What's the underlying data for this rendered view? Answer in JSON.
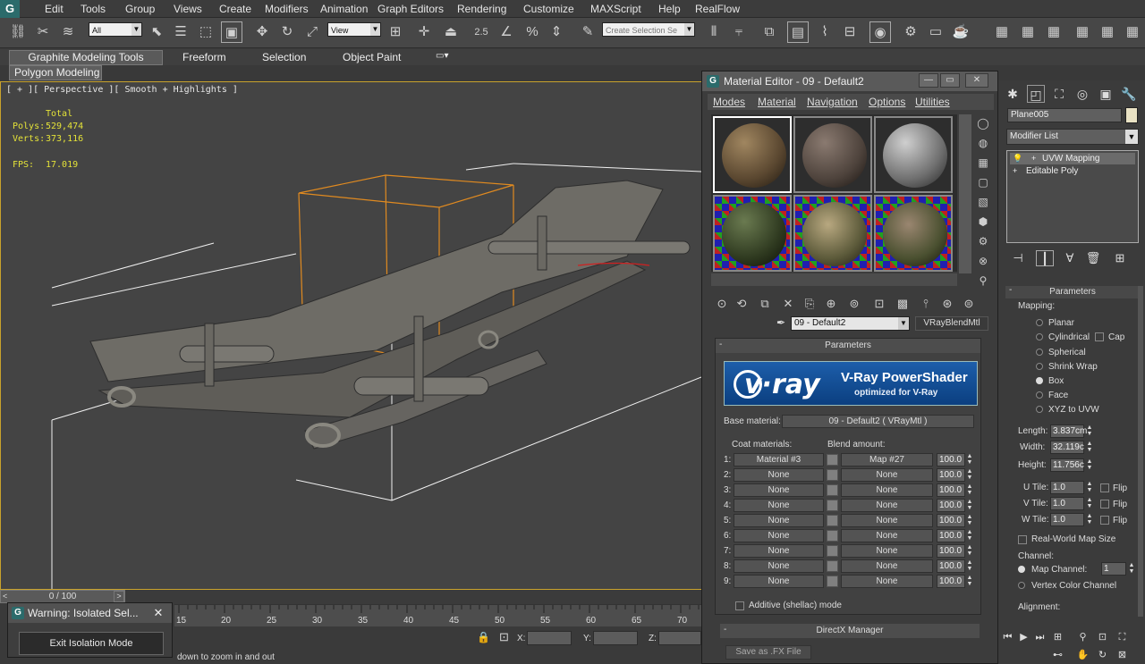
{
  "app": {
    "logo": "G"
  },
  "menus": [
    "Edit",
    "Tools",
    "Group",
    "Views",
    "Create",
    "Modifiers",
    "Animation",
    "Graph Editors",
    "Rendering",
    "Customize",
    "MAXScript",
    "Help",
    "RealFlow"
  ],
  "toolbar": {
    "filter_value": "All",
    "ref_coord_value": "View",
    "spinner_snap_label": "2.5",
    "named_selection_placeholder": "Create Selection Se"
  },
  "ribbon": {
    "tabs": [
      "Graphite Modeling Tools",
      "Freeform",
      "Selection",
      "Object Paint"
    ],
    "active_subtab": "Polygon Modeling"
  },
  "viewport": {
    "label": "[ + ][ Perspective ][ Smooth + Highlights ]",
    "stats": {
      "total": "Total",
      "polys_label": "Polys:",
      "polys": "529,474",
      "verts_label": "Verts:",
      "verts": "373,116",
      "fps_label": "FPS:",
      "fps": "17.019"
    }
  },
  "timeline": {
    "slider": "0 / 100",
    "ticks": [
      "15",
      "20",
      "25",
      "30",
      "35",
      "40",
      "45",
      "50",
      "55",
      "60",
      "65",
      "70"
    ]
  },
  "status": {
    "x_label": "X:",
    "y_label": "Y:",
    "z_label": "Z:",
    "hint": "down to zoom in and out"
  },
  "warning": {
    "title": "Warning: Isolated Sel...",
    "close": "✕",
    "button": "Exit Isolation Mode"
  },
  "material_editor": {
    "title": "Material Editor - 09 - Default2",
    "menu": [
      "Modes",
      "Material",
      "Navigation",
      "Options",
      "Utilities"
    ],
    "material_name": "09 - Default2",
    "material_type": "VRayBlendMtl",
    "params_header": "Parameters",
    "vray": {
      "logo": "v·ray",
      "title": "V-Ray PowerShader",
      "subtitle": "optimized for V-Ray"
    },
    "base_material_label": "Base material:",
    "base_material_value": "09 - Default2  ( VRayMtl )",
    "coat_label": "Coat materials:",
    "blend_label": "Blend amount:",
    "coats": [
      {
        "idx": "1:",
        "material": "Material #3",
        "map": "Map #27",
        "amount": "100.0"
      },
      {
        "idx": "2:",
        "material": "None",
        "map": "None",
        "amount": "100.0"
      },
      {
        "idx": "3:",
        "material": "None",
        "map": "None",
        "amount": "100.0"
      },
      {
        "idx": "4:",
        "material": "None",
        "map": "None",
        "amount": "100.0"
      },
      {
        "idx": "5:",
        "material": "None",
        "map": "None",
        "amount": "100.0"
      },
      {
        "idx": "6:",
        "material": "None",
        "map": "None",
        "amount": "100.0"
      },
      {
        "idx": "7:",
        "material": "None",
        "map": "None",
        "amount": "100.0"
      },
      {
        "idx": "8:",
        "material": "None",
        "map": "None",
        "amount": "100.0"
      },
      {
        "idx": "9:",
        "material": "None",
        "map": "None",
        "amount": "100.0"
      }
    ],
    "additive_label": "Additive (shellac) mode",
    "directx_header": "DirectX Manager",
    "save_fx": "Save as .FX File"
  },
  "command_panel": {
    "object_name": "Plane005",
    "modifier_list": "Modifier List",
    "stack": [
      "UVW Mapping",
      "Editable Poly"
    ],
    "parameters_header": "Parameters",
    "mapping_label": "Mapping:",
    "mapping_options": [
      "Planar",
      "Cylindrical",
      "Spherical",
      "Shrink Wrap",
      "Box",
      "Face",
      "XYZ to UVW"
    ],
    "selected_mapping": "Box",
    "cap_label": "Cap",
    "length_label": "Length:",
    "length": "3.837cm",
    "width_label": "Width:",
    "width": "32.119c",
    "height_label": "Height:",
    "height": "11.756c",
    "utile_label": "U Tile:",
    "utile": "1.0",
    "vtile_label": "V Tile:",
    "vtile": "1.0",
    "wtile_label": "W Tile:",
    "wtile": "1.0",
    "flip_label": "Flip",
    "real_world_label": "Real-World Map Size",
    "channel_label": "Channel:",
    "map_channel_label": "Map Channel:",
    "map_channel": "1",
    "vertex_color_label": "Vertex Color Channel",
    "alignment_label": "Alignment:"
  },
  "colors": {
    "accent": "#c9a22c",
    "selection_box": "#e08a20",
    "stats": "#e4e238",
    "vray_blue": "#1d5eaa"
  }
}
